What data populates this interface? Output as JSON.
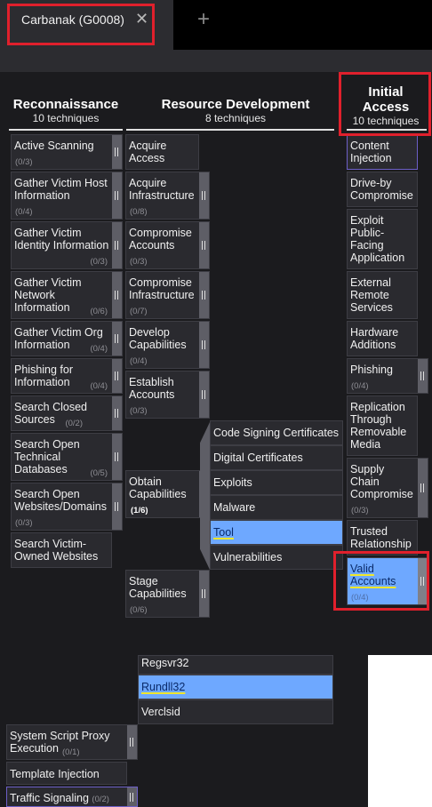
{
  "tab": {
    "title": "Carbanak (G0008)",
    "close": "✕",
    "add": "+"
  },
  "columns": {
    "recon": {
      "name": "Reconnaissance",
      "count": "10  techniques"
    },
    "resdev": {
      "name": "Resource Development",
      "count": "8  techniques"
    },
    "initial": {
      "name1": "Initial",
      "name2": "Access",
      "count": "10  techniques"
    }
  },
  "recon": [
    {
      "label": "Active Scanning",
      "count": "(0/3)"
    },
    {
      "label": "Gather Victim Host Information",
      "count": "(0/4)"
    },
    {
      "label": "Gather Victim Identity Information",
      "count": "(0/3)"
    },
    {
      "label": "Gather Victim Network Information",
      "count": "(0/6)"
    },
    {
      "label": "Gather Victim Org Information",
      "count": "(0/4)"
    },
    {
      "label": "Phishing for Information",
      "count": "(0/4)"
    },
    {
      "label": "Search Closed Sources",
      "count": "(0/2)"
    },
    {
      "label": "Search Open Technical Databases",
      "count": "(0/5)"
    },
    {
      "label": "Search Open Websites/Domains",
      "count": "(0/3)"
    },
    {
      "label": "Search Victim-Owned Websites",
      "count": ""
    }
  ],
  "resdev": [
    {
      "label": "Acquire Access",
      "count": ""
    },
    {
      "label": "Acquire Infrastructure",
      "count": "(0/8)"
    },
    {
      "label": "Compromise Accounts",
      "count": "(0/3)"
    },
    {
      "label": "Compromise Infrastructure",
      "count": "(0/7)"
    },
    {
      "label": "Develop Capabilities",
      "count": "(0/4)"
    },
    {
      "label": "Establish Accounts",
      "count": "(0/3)"
    },
    {
      "label": "Obtain Capabilities",
      "count": "(1/6)"
    },
    {
      "label": "Stage Capabilities",
      "count": "(0/6)"
    }
  ],
  "obtain_subs": [
    "Code Signing Certificates",
    "Digital Certificates",
    "Exploits",
    "Malware",
    "Tool",
    "Vulnerabilities"
  ],
  "initial": [
    {
      "label": "Content Injection",
      "count": ""
    },
    {
      "label": "Drive-by Compromise",
      "count": ""
    },
    {
      "label": "Exploit Public-Facing Application",
      "count": ""
    },
    {
      "label": "External Remote Services",
      "count": ""
    },
    {
      "label": "Hardware Additions",
      "count": ""
    },
    {
      "label": "Phishing",
      "count": "(0/4)"
    },
    {
      "label": "Replication Through Removable Media",
      "count": ""
    },
    {
      "label": "Supply Chain Compromise",
      "count": "(0/3)"
    },
    {
      "label": "Trusted Relationship",
      "count": ""
    },
    {
      "label": "Valid Accounts",
      "count": "(0/4)"
    }
  ],
  "lower": {
    "subs": [
      "Regsvr32",
      "Rundll32",
      "Verclsid"
    ],
    "items": [
      {
        "label": "System Script Proxy Execution",
        "count": "(0/1)"
      },
      {
        "label": "Template Injection",
        "count": ""
      },
      {
        "label": "Traffic Signaling",
        "count": "(0/2)"
      }
    ]
  },
  "colors": {
    "selected": "#6ea8ff",
    "highlight": "#e0202c",
    "underline": "#f0e62a"
  }
}
